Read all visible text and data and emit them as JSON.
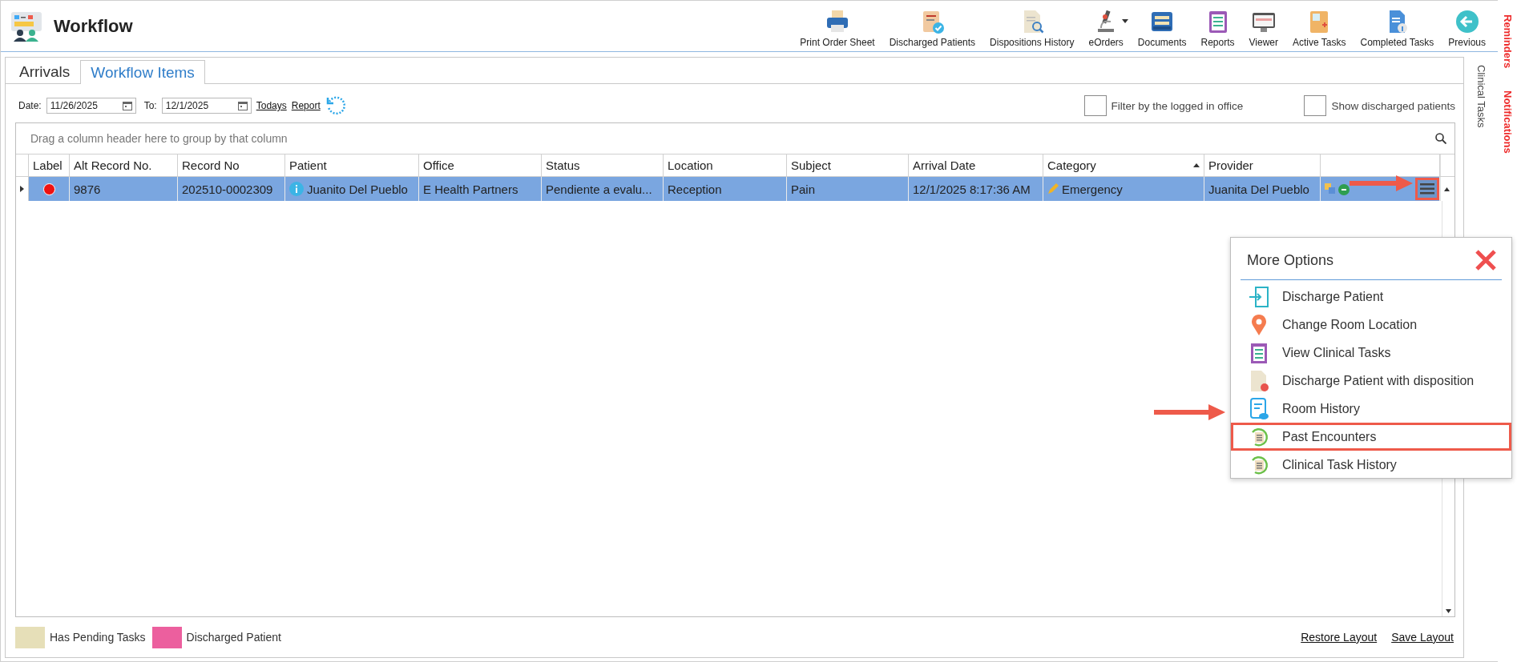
{
  "window": {
    "title": "Workflow"
  },
  "toolbar": [
    {
      "label": "Print Order Sheet"
    },
    {
      "label": "Discharged Patients"
    },
    {
      "label": "Dispositions History"
    },
    {
      "label": "eOrders",
      "has_dropdown": true
    },
    {
      "label": "Documents"
    },
    {
      "label": "Reports"
    },
    {
      "label": "Viewer"
    },
    {
      "label": "Active Tasks"
    },
    {
      "label": "Completed Tasks"
    },
    {
      "label": "Previous"
    }
  ],
  "side_tabs": [
    {
      "label": "Reminders"
    },
    {
      "label": "Notifications"
    }
  ],
  "clinical_tasks_tab": {
    "label": "Clinical Tasks"
  },
  "tabs": [
    {
      "label": "Arrivals",
      "selected": false
    },
    {
      "label": "Workflow Items",
      "selected": true
    }
  ],
  "filters": {
    "date_label": "Date:",
    "date_from": "11/26/2025",
    "to_label": "To:",
    "date_to": "12/1/2025",
    "todays_link": "Todays",
    "report_link": "Report"
  },
  "checkboxes": [
    {
      "label": "Filter by the logged in office",
      "checked": false
    },
    {
      "label": "Show discharged patients",
      "checked": false
    }
  ],
  "grid": {
    "group_panel_hint": "Drag a column header here to group by that column",
    "columns": [
      {
        "label": "Label"
      },
      {
        "label": "Alt Record No."
      },
      {
        "label": "Record No"
      },
      {
        "label": "Patient"
      },
      {
        "label": "Office"
      },
      {
        "label": "Status"
      },
      {
        "label": "Location"
      },
      {
        "label": "Subject"
      },
      {
        "label": "Arrival Date"
      },
      {
        "label": "Category",
        "sorted_ascending": true
      },
      {
        "label": "Provider"
      }
    ],
    "rows": [
      {
        "selected": true,
        "color": "#ee1111",
        "menu_highlighted": true,
        "cells": [
          {
            "kind": "dot"
          },
          {
            "kind": "text",
            "text": "9876"
          },
          {
            "kind": "text",
            "text": "202510-0002309"
          },
          {
            "kind": "patient",
            "text": "Juanito Del Pueblo"
          },
          {
            "kind": "text",
            "text": "E Health Partners"
          },
          {
            "kind": "text",
            "text": "Pendiente a evalu..."
          },
          {
            "kind": "text",
            "text": "Reception"
          },
          {
            "kind": "text",
            "text": "Pain"
          },
          {
            "kind": "text",
            "text": "12/1/2025 8:17:36 AM"
          },
          {
            "kind": "category",
            "text": "Emergency"
          },
          {
            "kind": "text",
            "text": "Juanita Del Pueblo"
          }
        ]
      }
    ]
  },
  "legend": [
    {
      "label": "Has Pending Tasks",
      "color": "#e6dfb8"
    },
    {
      "label": "Discharged Patient",
      "color": "#ec5f9e"
    }
  ],
  "layout_links": [
    "Restore Layout",
    "Save Layout"
  ],
  "more_options": {
    "title": "More Options",
    "items": [
      {
        "label": "Discharge Patient",
        "highlighted": false
      },
      {
        "label": "Change Room Location",
        "highlighted": false
      },
      {
        "label": "View Clinical Tasks",
        "highlighted": false
      },
      {
        "label": "Discharge Patient with disposition",
        "highlighted": false
      },
      {
        "label": "Room History",
        "highlighted": false
      },
      {
        "label": "Past Encounters",
        "highlighted": true
      },
      {
        "label": "Clinical Task History",
        "highlighted": false
      }
    ]
  }
}
